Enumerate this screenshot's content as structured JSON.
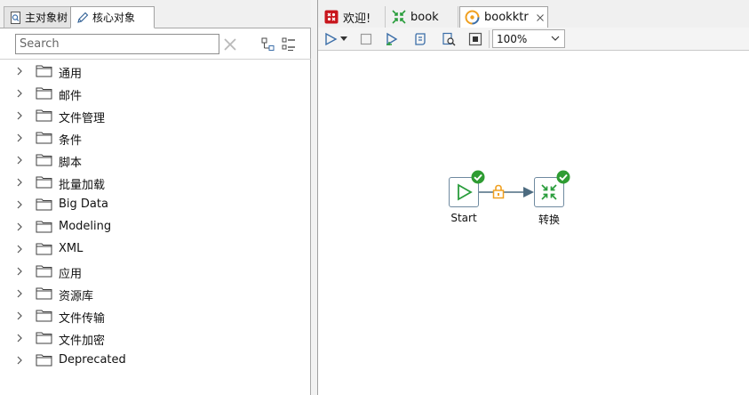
{
  "left_panel": {
    "tabs": [
      {
        "label": "主对象树",
        "icon": "tree-view-icon",
        "active": false
      },
      {
        "label": "核心对象",
        "icon": "pencil-icon",
        "active": true
      }
    ],
    "search": {
      "placeholder": "Search",
      "value": ""
    },
    "tree_items": [
      {
        "label": "通用"
      },
      {
        "label": "邮件"
      },
      {
        "label": "文件管理"
      },
      {
        "label": "条件"
      },
      {
        "label": "脚本"
      },
      {
        "label": "批量加载"
      },
      {
        "label": "Big Data"
      },
      {
        "label": "Modeling"
      },
      {
        "label": "XML"
      },
      {
        "label": "应用"
      },
      {
        "label": "资源库"
      },
      {
        "label": "文件传输"
      },
      {
        "label": "文件加密"
      },
      {
        "label": "Deprecated"
      }
    ]
  },
  "editor": {
    "tabs": [
      {
        "label": "欢迎!",
        "icon": "welcome-icon",
        "active": false
      },
      {
        "label": "book",
        "icon": "transformation-icon",
        "active": false
      },
      {
        "label": "bookktr",
        "icon": "job-icon",
        "active": true,
        "closable": true
      }
    ],
    "toolbar": {
      "zoom": "100%"
    },
    "nodes": {
      "start": {
        "label": "Start",
        "status": "success"
      },
      "transform": {
        "label": "转换",
        "status": "success"
      }
    },
    "colors": {
      "success_green": "#2e9c32",
      "node_border": "#6f8aa0",
      "hop_arrow": "#4d6b80",
      "lock_orange": "#f0a020",
      "play_green": "#2a9d3c"
    }
  }
}
